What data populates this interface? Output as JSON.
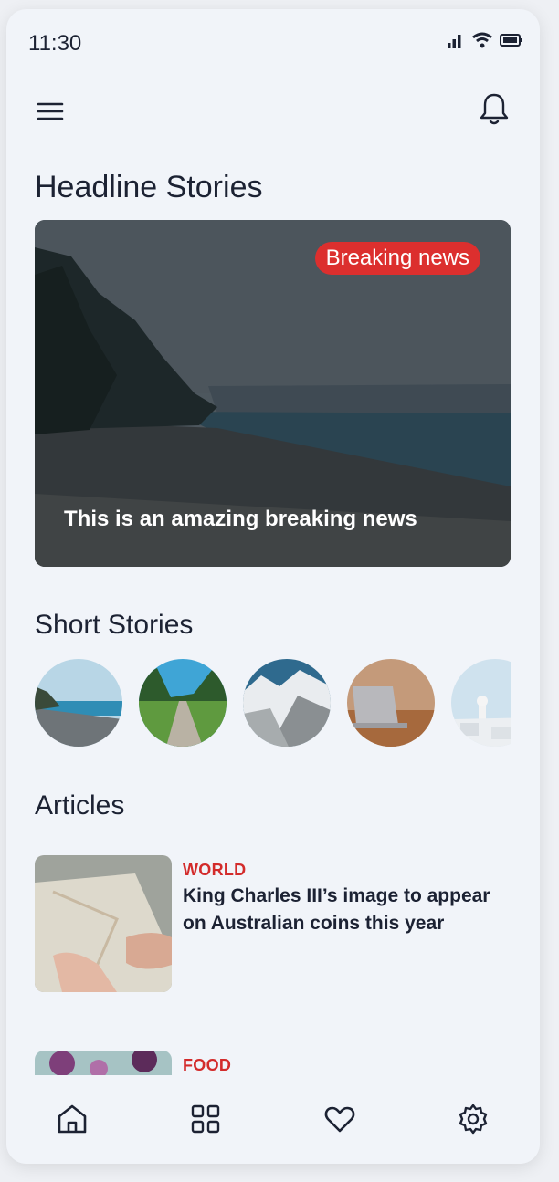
{
  "status": {
    "time": "11:30",
    "icons": [
      "signal-icon",
      "wifi-icon",
      "battery-icon"
    ]
  },
  "topbar": {
    "menu_icon": "menu-icon",
    "bell_icon": "bell-icon"
  },
  "headline": {
    "title": "Headline Stories",
    "badge": "Breaking news",
    "caption": "This is an amazing breaking news",
    "badge_color": "#dc2f2e"
  },
  "short_stories": {
    "title": "Short Stories",
    "items": [
      "beach",
      "path",
      "mountains",
      "laptop",
      "village"
    ]
  },
  "articles": {
    "title": "Articles",
    "items": [
      {
        "category": "WORLD",
        "title": "King Charles III’s image to appear on Australian coins this year"
      },
      {
        "category": "FOOD",
        "title": ""
      }
    ],
    "category_color": "#d32b2b"
  },
  "bottom_nav": {
    "items": [
      "home-icon",
      "grid-icon",
      "heart-icon",
      "settings-icon"
    ]
  }
}
